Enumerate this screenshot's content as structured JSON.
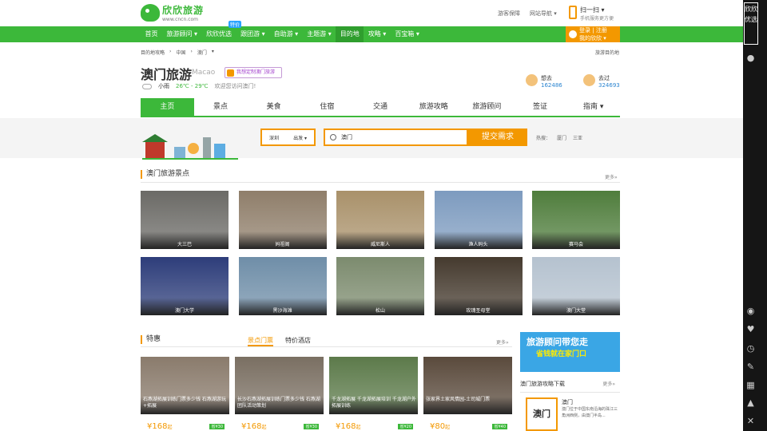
{
  "header": {
    "logo_cn": "欣欣旅游",
    "logo_en": "www.cncn.com",
    "links": [
      "游客保障",
      "网站导航 ▾"
    ],
    "scan_title": "扫一扫 ▾",
    "scan_sub": "手机服务更方便"
  },
  "nav": {
    "items": [
      "首页",
      "旅游顾问 ▾",
      "欣欣优选",
      "跟团游 ▾",
      "自助游 ▾",
      "主题游 ▾",
      "目的地",
      "攻略 ▾",
      "百宝箱 ▾"
    ],
    "badge": "特价",
    "login_line1": "登录 | 注册",
    "login_line2": "我的欣欣 ▾"
  },
  "breadcrumb": {
    "items": [
      "目的地攻略",
      "›",
      "中国",
      "›",
      "澳门",
      "▾"
    ],
    "right": "旅游目的地"
  },
  "dest": {
    "title": "澳门旅游",
    "title_en": "Macao",
    "tag": "我想定制澳门旅游",
    "weather": "小雨",
    "temp": "26℃ - 29℃",
    "welcome": "欢迎您访问澳门!"
  },
  "stats": [
    {
      "label": "想去",
      "num": "162486"
    },
    {
      "label": "去过",
      "num": "324693"
    }
  ],
  "tabs": [
    "主页",
    "景点",
    "美食",
    "住宿",
    "交通",
    "旅游攻略",
    "旅游顾问",
    "签证",
    "指南 ▾"
  ],
  "search": {
    "city": "深圳",
    "depart": "出发 ▾",
    "query": "澳门",
    "submit": "提交需求",
    "hot_label": "热搜：",
    "hot": [
      "厦门",
      "三亚"
    ]
  },
  "attractions": {
    "title": "澳门旅游景点",
    "more": "更多»",
    "items": [
      {
        "name": "大三巴",
        "color": "#6b6a66"
      },
      {
        "name": "妈祖阁",
        "color": "#8f7e6a"
      },
      {
        "name": "威尼斯人",
        "color": "#a9916a"
      },
      {
        "name": "渔人码头",
        "color": "#7d9bbf"
      },
      {
        "name": "赛马会",
        "color": "#4f7d3c"
      },
      {
        "name": "澳门大学",
        "color": "#2d3d7a"
      },
      {
        "name": "黑沙海滩",
        "color": "#6f8ea8"
      },
      {
        "name": "松山",
        "color": "#7c8b6e"
      },
      {
        "name": "玫瑰圣母堂",
        "color": "#453a2e"
      },
      {
        "name": "澳门大堂",
        "color": "#b5c2cf"
      }
    ]
  },
  "deals": {
    "title": "特惠",
    "tabs": [
      "景点门票",
      "特价酒店"
    ],
    "more": "更多»",
    "items": [
      {
        "caption": "石燕湖拓展训练门票多少钱 石燕湖游玩+拓展",
        "price": "¥168",
        "unit": "起",
        "save": "省¥30",
        "color": "#8a7b6c"
      },
      {
        "caption": "长沙石燕湖拓展训练门票多少钱 石燕湖团队活动策划",
        "price": "¥168",
        "unit": "起",
        "save": "省¥30",
        "color": "#7a6f62"
      },
      {
        "caption": "千龙湖拓展 千龙湖拓展培训 千龙湖户外拓展训练",
        "price": "¥168",
        "unit": "起",
        "save": "省¥20",
        "color": "#5c7a4a"
      },
      {
        "caption": "张家界土家风情园-土司城门票",
        "price": "¥80",
        "unit": "起",
        "save": "省¥40",
        "color": "#5a4a3c"
      }
    ]
  },
  "ad": {
    "line1": "旅游顾问带您走",
    "line2": "省钱就在家门口"
  },
  "guide": {
    "title": "澳门旅游攻略下载",
    "more": "更多»",
    "book": "澳门",
    "name": "澳门",
    "desc": "澳门位于中国东南沿海的珠江三角洲西侧，由澳门半岛..."
  },
  "sidebar": {
    "brand": "欣欣优选"
  }
}
